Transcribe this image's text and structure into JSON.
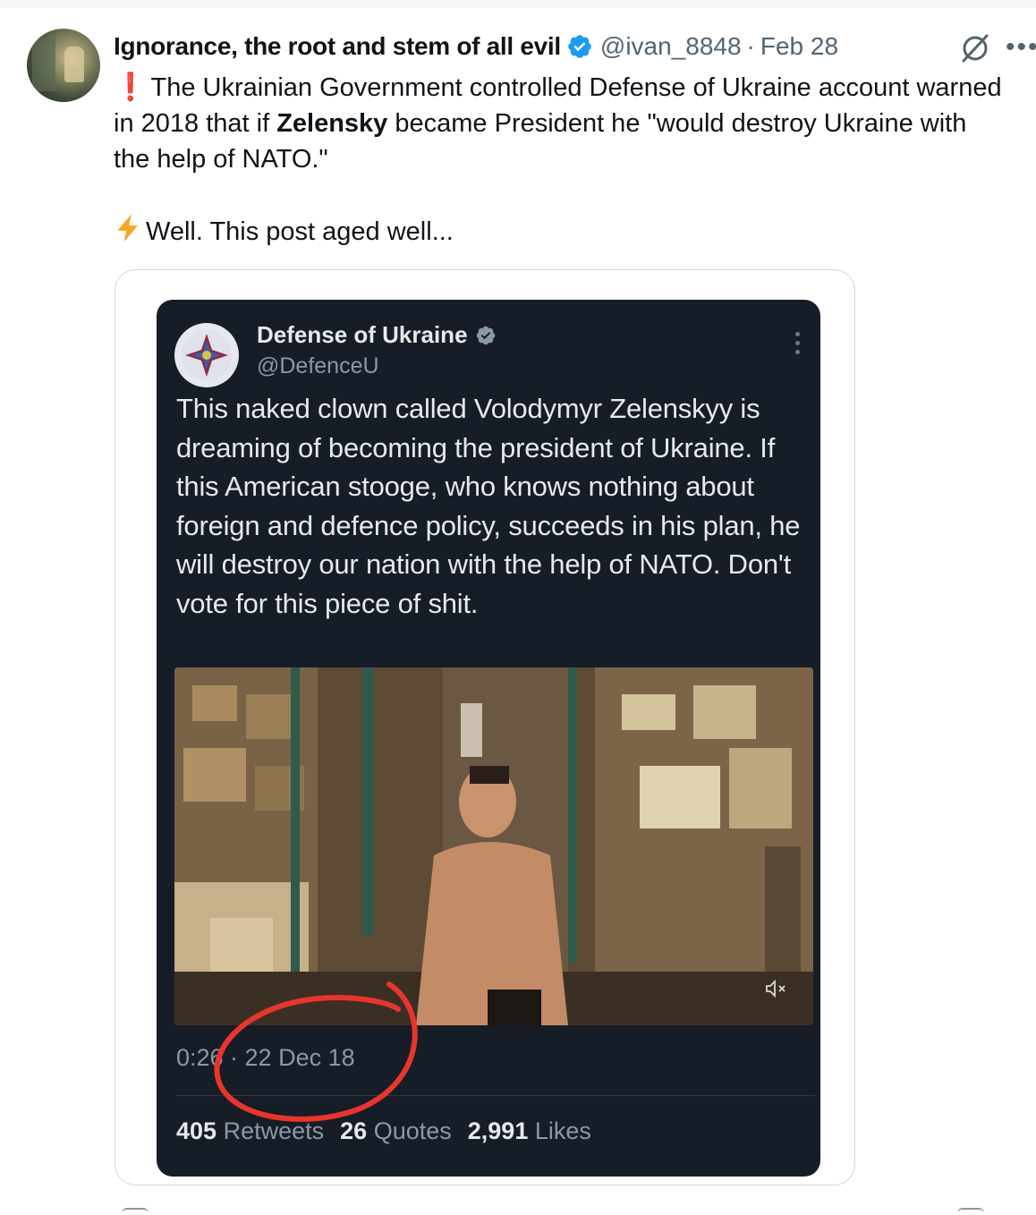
{
  "tweet": {
    "display_name": "Ignorance, the root and stem of all evil",
    "handle": "@ivan_8848",
    "separator": "·",
    "date": "Feb 28",
    "text_line1_a": " The Ukrainian Government controlled Defense of Ukraine account warned in 2018 that if ",
    "text_bold": "Zelensky",
    "text_line1_b": " became President he \"would destroy Ukraine with the help of NATO.\"",
    "text_line2": "Well. This post aged well...",
    "excl_emoji": "❗",
    "icons": [
      "verified-badge-icon",
      "grok-icon",
      "more-icon",
      "exclamation-emoji",
      "lightning-emoji"
    ]
  },
  "embedded": {
    "name": "Defense of Ukraine",
    "handle": "@DefenceU",
    "text": "This naked clown called Volodymyr Zelenskyy is dreaming of becoming the president of Ukraine. If this American stooge, who knows nothing about foreign and defence policy, succeeds in his plan, he will destroy our nation with the help of NATO. Don't vote for this piece of shit.",
    "meta": "0:26 · 22 Dec 18",
    "retweets_count": "405",
    "retweets_label": "Retweets",
    "quotes_count": "26",
    "quotes_label": "Quotes",
    "likes_count": "2,991",
    "likes_label": "Likes"
  },
  "colors": {
    "verified_blue": "#1d9bf0",
    "annotation_red": "#e8352b",
    "embedded_bg": "#161d27"
  }
}
